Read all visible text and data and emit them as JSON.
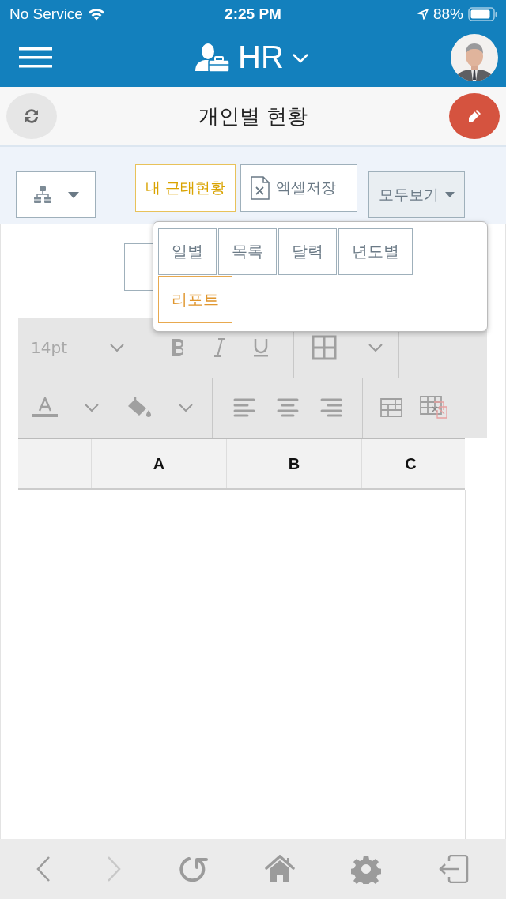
{
  "status_bar": {
    "carrier": "No Service",
    "time": "2:25 PM",
    "battery": "88%"
  },
  "header": {
    "title": "HR"
  },
  "page_title": "개인별 현황",
  "toolbar": {
    "my_status": {
      "label": "내 근태현황",
      "selected": true
    },
    "excel": {
      "label": "엑셀저장"
    },
    "view": {
      "label": "모두보기",
      "expanded": true
    }
  },
  "view_menu": [
    {
      "label": "일별",
      "selected": false
    },
    {
      "label": "목록",
      "selected": false
    },
    {
      "label": "달력",
      "selected": false
    },
    {
      "label": "년도별",
      "selected": false
    },
    {
      "label": "리포트",
      "selected": true
    }
  ],
  "editor": {
    "font_size": "14pt",
    "columns": [
      "A",
      "B",
      "C"
    ]
  },
  "bottom_nav": [
    {
      "kind": "back",
      "disabled": false
    },
    {
      "kind": "forward",
      "disabled": true
    },
    {
      "kind": "reload",
      "disabled": false
    },
    {
      "kind": "home",
      "disabled": false
    },
    {
      "kind": "settings",
      "disabled": false
    },
    {
      "kind": "logout",
      "disabled": false
    }
  ]
}
